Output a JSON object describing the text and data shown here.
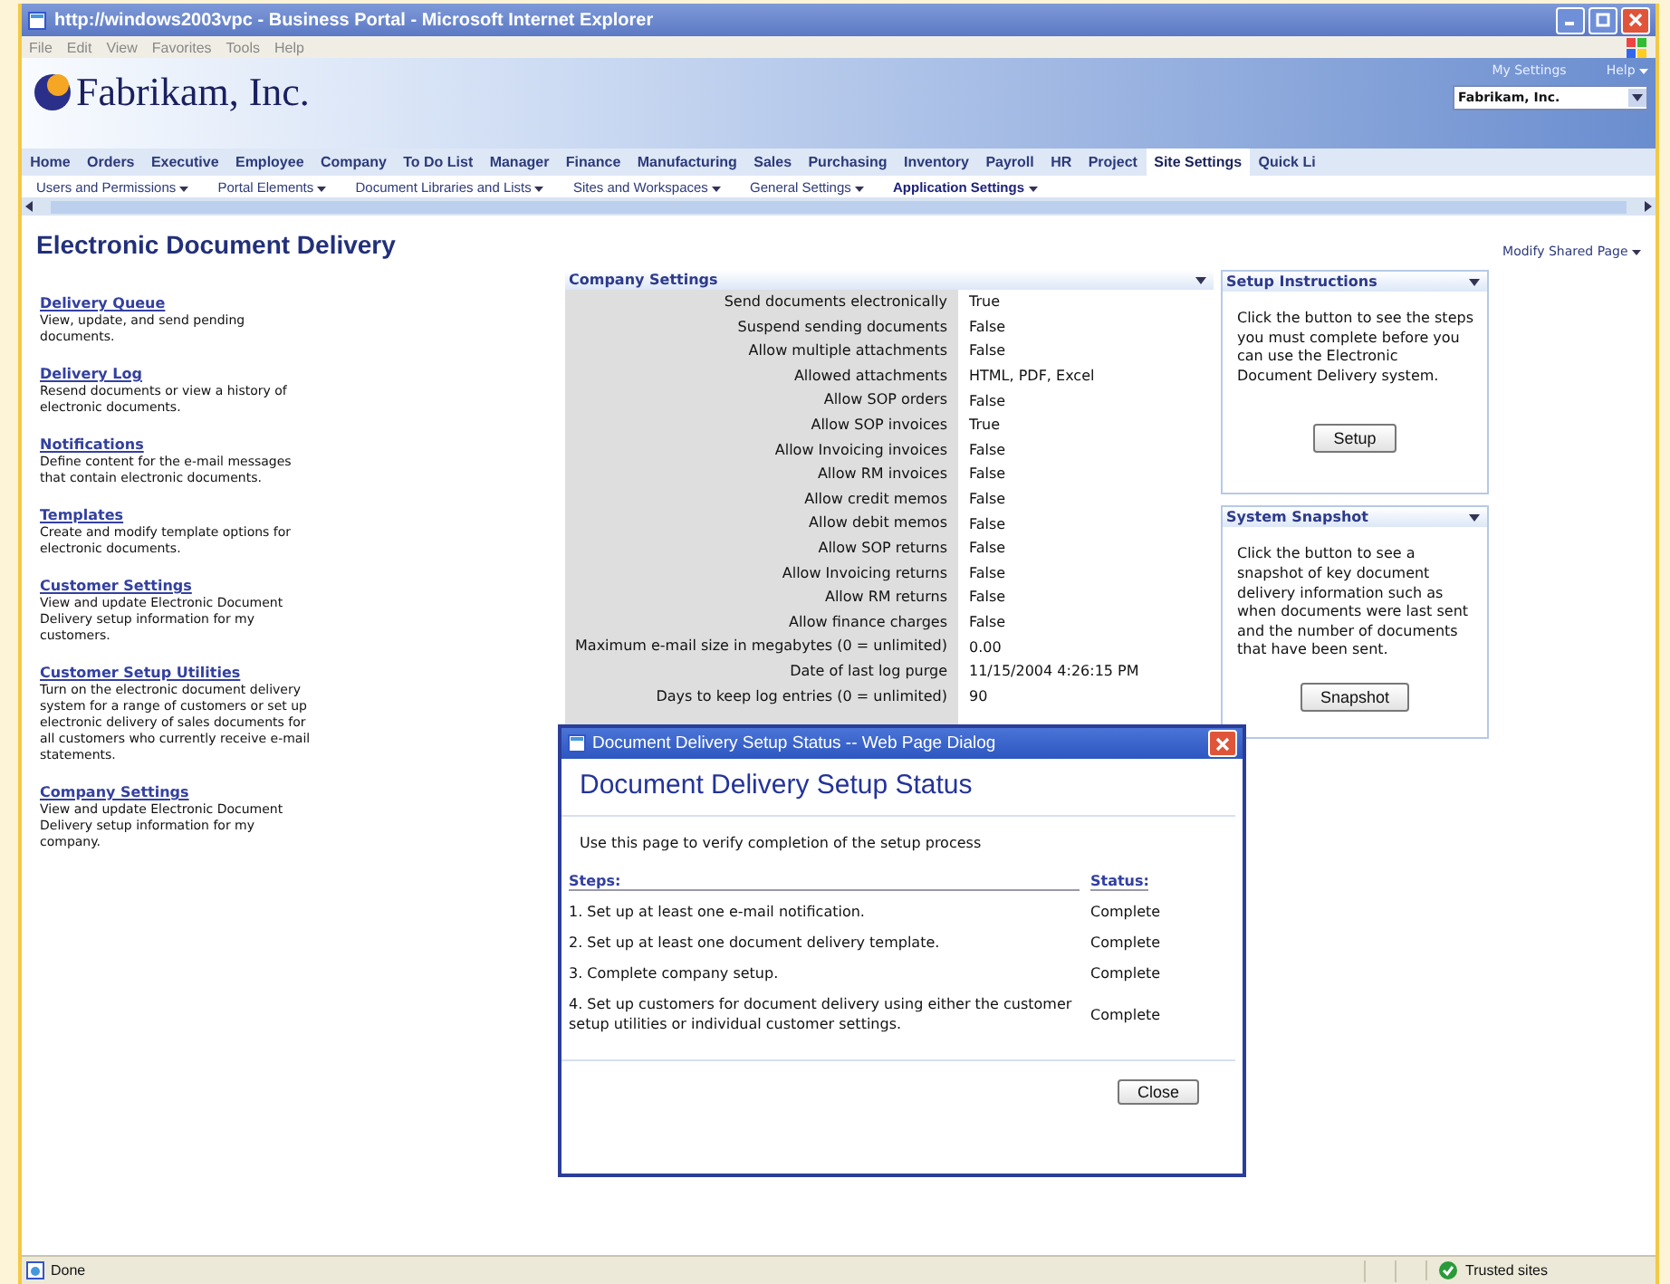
{
  "window": {
    "title": "http://windows2003vpc - Business Portal - Microsoft Internet Explorer"
  },
  "menu_bar": [
    "File",
    "Edit",
    "View",
    "Favorites",
    "Tools",
    "Help"
  ],
  "portal": {
    "logo": "Fabrikam, Inc.",
    "links": [
      "My Settings",
      "Help"
    ],
    "company_select": "Fabrikam, Inc."
  },
  "nav_tabs": [
    {
      "label": "Home",
      "selected": false
    },
    {
      "label": "Orders",
      "selected": false
    },
    {
      "label": "Executive",
      "selected": false
    },
    {
      "label": "Employee",
      "selected": false
    },
    {
      "label": "Company",
      "selected": false
    },
    {
      "label": "To Do List",
      "selected": false
    },
    {
      "label": "Manager",
      "selected": false
    },
    {
      "label": "Finance",
      "selected": false
    },
    {
      "label": "Manufacturing",
      "selected": false
    },
    {
      "label": "Sales",
      "selected": false
    },
    {
      "label": "Purchasing",
      "selected": false
    },
    {
      "label": "Inventory",
      "selected": false
    },
    {
      "label": "Payroll",
      "selected": false
    },
    {
      "label": "HR",
      "selected": false
    },
    {
      "label": "Project",
      "selected": false
    },
    {
      "label": "Site Settings",
      "selected": true
    },
    {
      "label": "Quick Li",
      "selected": false
    }
  ],
  "sub_nav": [
    {
      "label": "Users and Permissions",
      "selected": false
    },
    {
      "label": "Portal Elements",
      "selected": false
    },
    {
      "label": "Document Libraries and Lists",
      "selected": false
    },
    {
      "label": "Sites and Workspaces",
      "selected": false
    },
    {
      "label": "General Settings",
      "selected": false
    },
    {
      "label": "Application Settings",
      "selected": true
    }
  ],
  "page": {
    "title": "Electronic Document Delivery",
    "modify_link": "Modify Shared Page"
  },
  "links": [
    {
      "title": "Delivery Queue",
      "description": "View, update, and send pending documents."
    },
    {
      "title": "Delivery Log",
      "description": "Resend documents or view a history of electronic documents."
    },
    {
      "title": "Notifications",
      "description": "Define content for the e-mail messages that contain electronic documents."
    },
    {
      "title": "Templates",
      "description": "Create and modify template options for electronic documents."
    },
    {
      "title": "Customer Settings",
      "description": "View and update Electronic Document Delivery setup information for my customers."
    },
    {
      "title": "Customer Setup Utilities",
      "description": "Turn on the electronic document delivery system for a range of customers or set up electronic delivery of sales documents for all customers who currently receive e-mail statements."
    },
    {
      "title": "Company Settings",
      "description": "View and update Electronic Document Delivery setup information for my company."
    }
  ],
  "company_settings": {
    "title": "Company Settings",
    "rows": [
      {
        "label": "Send documents electronically",
        "value": "True"
      },
      {
        "label": "Suspend sending documents",
        "value": "False"
      },
      {
        "label": "Allow multiple attachments",
        "value": "False"
      },
      {
        "label": "Allowed attachments",
        "value": "HTML, PDF, Excel"
      },
      {
        "label": "Allow SOP orders",
        "value": "False"
      },
      {
        "label": "Allow SOP invoices",
        "value": "True"
      },
      {
        "label": "Allow Invoicing invoices",
        "value": "False"
      },
      {
        "label": "Allow RM invoices",
        "value": "False"
      },
      {
        "label": "Allow credit memos",
        "value": "False"
      },
      {
        "label": "Allow debit memos",
        "value": "False"
      },
      {
        "label": "Allow SOP returns",
        "value": "False"
      },
      {
        "label": "Allow Invoicing returns",
        "value": "False"
      },
      {
        "label": "Allow RM returns",
        "value": "False"
      },
      {
        "label": "Allow finance charges",
        "value": "False"
      },
      {
        "label": "Maximum e-mail size in megabytes (0 = unlimited)",
        "value": "0.00"
      },
      {
        "label": "Date of last log purge",
        "value": "11/15/2004 4:26:15 PM"
      },
      {
        "label": "Days to keep log entries (0 = unlimited)",
        "value": "90"
      }
    ]
  },
  "side_panels": [
    {
      "title": "Setup Instructions",
      "text": "Click the button to see the steps you must complete before you can use the Electronic Document Delivery system.",
      "button": "Setup"
    },
    {
      "title": "System Snapshot",
      "text": "Click the button to see a snapshot of key document delivery information such as when documents were last sent and the number of documents that have been sent.",
      "button": "Snapshot"
    }
  ],
  "dialog": {
    "title": "Document Delivery Setup Status -- Web Page Dialog",
    "heading": "Document Delivery Setup Status",
    "intro": "Use this page to verify completion of the setup process",
    "columns": [
      "Steps:",
      "Status:"
    ],
    "steps": [
      {
        "step": "1. Set up at least one e-mail notification.",
        "status": "Complete"
      },
      {
        "step": "2. Set up at least one document delivery template.",
        "status": "Complete"
      },
      {
        "step": "3. Complete company setup.",
        "status": "Complete"
      },
      {
        "step": "4. Set up customers for document delivery using either the customer setup utilities or individual customer settings.",
        "status": "Complete"
      }
    ],
    "button": "Close"
  },
  "status_bar": {
    "text": "Done",
    "zone": "Trusted sites"
  }
}
